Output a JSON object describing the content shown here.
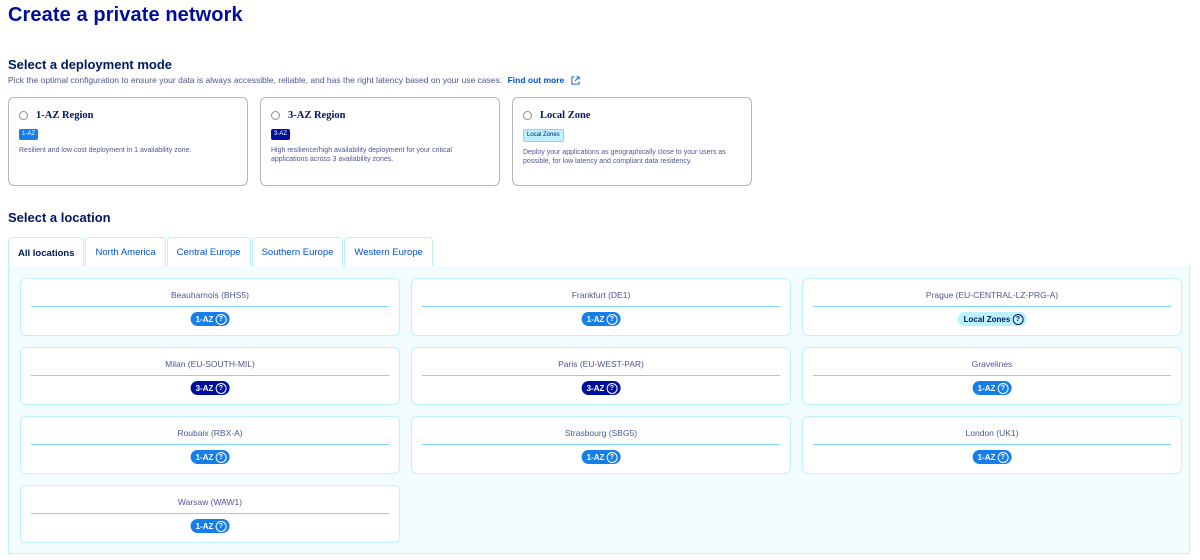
{
  "page": {
    "title": "Create a private network"
  },
  "deployment": {
    "title": "Select a deployment mode",
    "subtitle": "Pick the optimal configuration to ensure your data is always accessible, reliable, and has the right latency based on your use cases.",
    "link_label": "Find out more",
    "modes": [
      {
        "name": "1-AZ Region",
        "badge": "1-AZ",
        "description": "Resilient and low cost deployment in 1 availability zone."
      },
      {
        "name": "3-AZ Region",
        "badge": "3-AZ",
        "description": "High resilience/high availability deployment for your critical applications across 3 availability zones."
      },
      {
        "name": "Local Zone",
        "badge": "Local Zones",
        "description": "Deploy your applications as geographically close to your users as possible, for low latency and compliant data residency."
      }
    ]
  },
  "location": {
    "title": "Select a location",
    "tabs": [
      "All locations",
      "North America",
      "Central Europe",
      "Southern Europe",
      "Western Europe"
    ],
    "active_tab": "All locations",
    "help_glyph": "?",
    "cards": [
      {
        "name": "Beauharnois (BHS5)",
        "badge": "1-AZ"
      },
      {
        "name": "Frankfurt (DE1)",
        "badge": "1-AZ"
      },
      {
        "name": "Prague (EU-CENTRAL-LZ-PRG-A)",
        "badge": "Local Zones"
      },
      {
        "name": "Milan (EU-SOUTH-MIL)",
        "badge": "3-AZ"
      },
      {
        "name": "Paris (EU-WEST-PAR)",
        "badge": "3-AZ"
      },
      {
        "name": "Gravelines",
        "badge": "1-AZ"
      },
      {
        "name": "Roubaix (RBX-A)",
        "badge": "1-AZ"
      },
      {
        "name": "Strasbourg (SBG5)",
        "badge": "1-AZ"
      },
      {
        "name": "London (UK1)",
        "badge": "1-AZ"
      },
      {
        "name": "Warsaw (WAW1)",
        "badge": "1-AZ"
      }
    ]
  },
  "colors": {
    "primary": "#000e9c",
    "link": "#0050d7",
    "badge_1az": "#157eea",
    "badge_3az": "#000e9c",
    "badge_local": "#bef1ff",
    "panel_bg": "#f3fcff"
  },
  "icons": {
    "external_link": "external-link-icon",
    "help": "help-circle-icon"
  }
}
